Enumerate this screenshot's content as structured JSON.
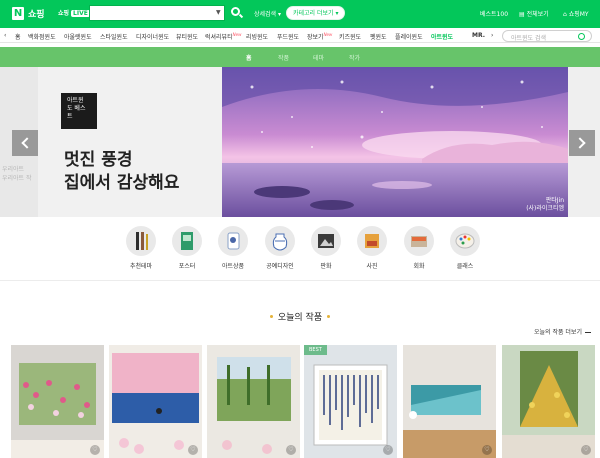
{
  "header": {
    "logo_letter": "N",
    "logo_text": "쇼핑",
    "live_label": "쇼핑",
    "live_badge": "LIVE",
    "search_placeholder": "",
    "detail_search": "상세검색",
    "window_chip": "카테고리 더보기",
    "best100": "베스트100",
    "all_view": "전체보기",
    "my": "쇼핑MY"
  },
  "category_nav": {
    "items": [
      {
        "label": "홈"
      },
      {
        "label": "백화점윈도"
      },
      {
        "label": "아울렛윈도"
      },
      {
        "label": "스타일윈도"
      },
      {
        "label": "디자이너윈도"
      },
      {
        "label": "뷰티윈도"
      },
      {
        "label": "럭셔리뷰티"
      },
      {
        "label": "리빙윈도"
      },
      {
        "label": "푸드윈도"
      },
      {
        "label": "장보기"
      },
      {
        "label": "키즈윈도"
      },
      {
        "label": "펫윈도"
      },
      {
        "label": "플레이윈도"
      },
      {
        "label": "아트윈도"
      },
      {
        "label": "MR."
      }
    ],
    "new_mark": "New",
    "search_placeholder": "아트윈도 검색"
  },
  "sub_nav": {
    "items": [
      {
        "label": "홈"
      },
      {
        "label": "작품"
      },
      {
        "label": "테마"
      },
      {
        "label": "작가"
      }
    ]
  },
  "hero": {
    "badge_line1": "아트윈",
    "badge_line2": "도 베스",
    "badge_line3": "트",
    "headline_line1": "멋진 풍경",
    "headline_line2": "집에서 감상해요",
    "credit_line1": "판타Jin",
    "credit_line2": "(사)라이크티엠",
    "peek_line1": "우리아트",
    "peek_line2": "우리아트 작"
  },
  "categories": [
    {
      "label": "추천테마",
      "icon": "brush-icon"
    },
    {
      "label": "포스터",
      "icon": "poster-icon"
    },
    {
      "label": "아트상품",
      "icon": "art-goods-icon"
    },
    {
      "label": "공예디자인",
      "icon": "vase-icon"
    },
    {
      "label": "판화",
      "icon": "print-icon"
    },
    {
      "label": "사진",
      "icon": "photo-icon"
    },
    {
      "label": "회화",
      "icon": "painting-icon"
    },
    {
      "label": "클래스",
      "icon": "palette-icon"
    }
  ],
  "today": {
    "title": "오늘의 작품",
    "more": "오늘의 작품 더보기"
  },
  "products": [
    {
      "name": "tulip-field"
    },
    {
      "name": "sea-sunset"
    },
    {
      "name": "garden"
    },
    {
      "name": "abstract-blue",
      "badge": "BEST"
    },
    {
      "name": "teal-abstract"
    },
    {
      "name": "golden-flowers"
    }
  ],
  "colors": {
    "brand": "#03c75a",
    "subnav": "#67c46a"
  }
}
